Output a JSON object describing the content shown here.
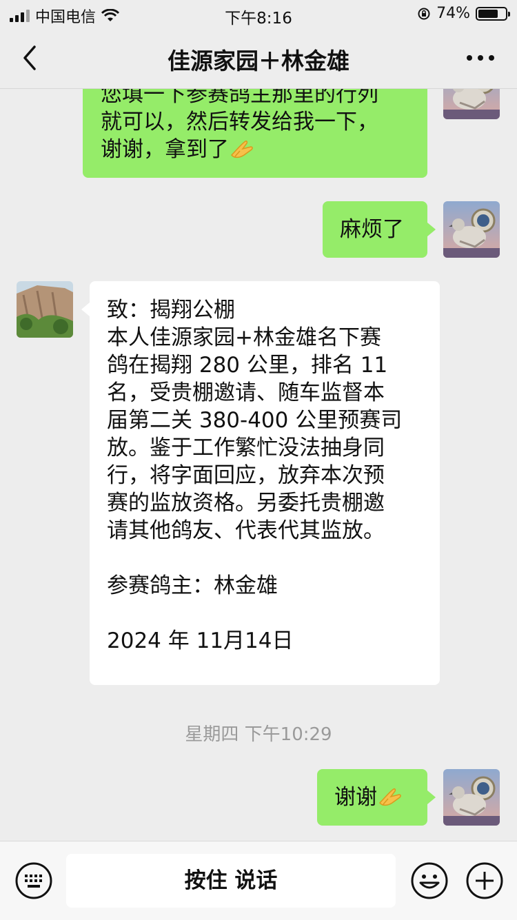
{
  "status_bar": {
    "carrier": "中国电信",
    "time": "下午8:16",
    "battery_percent": "74%",
    "battery_level": 0.74
  },
  "nav": {
    "title": "佳源家园＋林金雄",
    "back_icon": "chevron-left-icon",
    "more_icon": "more-dots-icon"
  },
  "messages": [
    {
      "side": "right",
      "type": "text",
      "lines": [
        "您填一下参赛鸽主那里的行列",
        "就可以，然后转发给我一下，",
        "谢谢，拿到了"
      ],
      "trailing_emoji": "pray-emoji"
    },
    {
      "side": "right",
      "type": "text",
      "lines": [
        "麻烦了"
      ]
    },
    {
      "side": "left",
      "type": "text",
      "lines": [
        "致：揭翔公棚",
        "本人佳源家园+林金雄名下赛",
        "鸽在揭翔 280 公里，排名 11",
        "名，受贵棚邀请、随车监督本",
        "届第二关 380-400 公里预赛司",
        "放。鉴于工作繁忙没法抽身同",
        "行，将字面回应，放弃本次预",
        "赛的监放资格。另委托贵棚邀",
        "请其他鸽友、代表代其监放。",
        "",
        "参赛鸽主：林金雄",
        "",
        "2024 年 11月14日"
      ]
    },
    {
      "type": "timestamp",
      "text": "星期四 下午10:29"
    },
    {
      "side": "right",
      "type": "text",
      "lines": [
        "谢谢"
      ],
      "trailing_emoji": "pray-emoji"
    }
  ],
  "input_bar": {
    "hold_to_talk": "按住 说话",
    "left_icon": "keyboard-icon",
    "emoji_icon": "smiley-icon",
    "plus_icon": "plus-icon"
  },
  "colors": {
    "bg": "#ededed",
    "green_bubble": "#95ec69",
    "white_bubble": "#ffffff"
  }
}
